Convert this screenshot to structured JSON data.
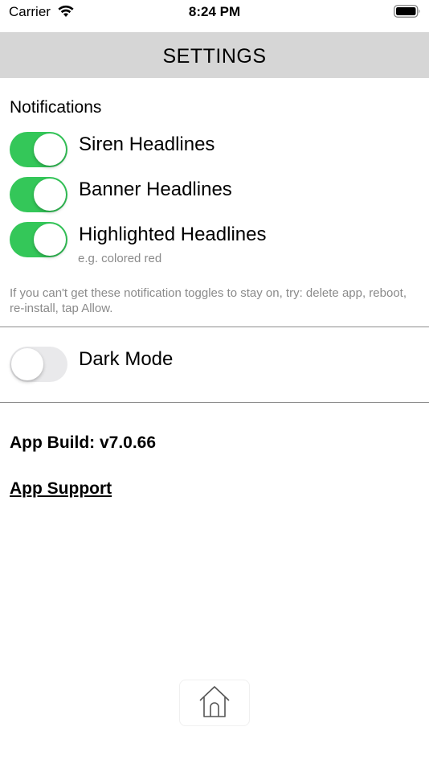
{
  "status_bar": {
    "carrier": "Carrier",
    "time": "8:24 PM",
    "wifi_icon": "wifi-icon",
    "battery_icon": "battery-icon"
  },
  "header": {
    "title": "SETTINGS"
  },
  "notifications": {
    "title": "Notifications",
    "toggles": [
      {
        "label": "Siren Headlines",
        "on": true
      },
      {
        "label": "Banner Headlines",
        "on": true
      },
      {
        "label": "Highlighted Headlines",
        "on": true,
        "subtext": "e.g. colored red"
      }
    ],
    "hint": "If you can't get these notification toggles to stay on, try: delete app, reboot, re-install, tap Allow."
  },
  "appearance": {
    "dark_mode": {
      "label": "Dark Mode",
      "on": false
    }
  },
  "footer": {
    "build": "App Build: v7.0.66",
    "support": "App Support"
  },
  "bottom": {
    "home_icon": "home-icon"
  },
  "colors": {
    "toggle_on": "#34c759",
    "toggle_off": "#e9e9eb",
    "header_bg": "#d6d6d6",
    "hint_text": "#8a8a8a"
  }
}
